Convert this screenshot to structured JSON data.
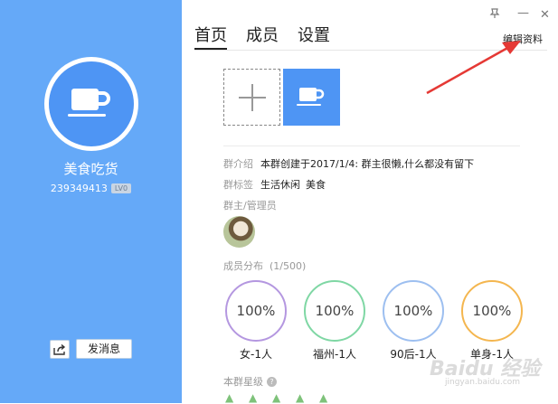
{
  "profile": {
    "name": "美食吃货",
    "group_id": "239349413",
    "level": "LV0",
    "send_message_label": "发消息",
    "share_icon": "share-icon",
    "avatar_icon": "coffee-cup-icon"
  },
  "tabs": [
    {
      "label": "首页",
      "active": true
    },
    {
      "label": "成员",
      "active": false
    },
    {
      "label": "设置",
      "active": false
    }
  ],
  "window": {
    "pin_icon": "pin-icon",
    "minimize_glyph": "—",
    "close_glyph": "✕",
    "edit_profile_label": "编辑资料"
  },
  "intro": {
    "label": "群介绍",
    "text": "本群创建于2017/1/4:  群主很懒,什么都没有留下"
  },
  "tags": {
    "label": "群标签",
    "items": [
      "生活休闲",
      "美食"
    ]
  },
  "admins": {
    "label": "群主/管理员"
  },
  "distribution": {
    "label": "成员分布",
    "total": "(1/500)",
    "stats": [
      {
        "value": "100%",
        "label": "女-1人",
        "color": "#b497e0"
      },
      {
        "value": "100%",
        "label": "福州-1人",
        "color": "#7fd7a4"
      },
      {
        "value": "100%",
        "label": "90后-1人",
        "color": "#9dbff0"
      },
      {
        "value": "100%",
        "label": "单身-1人",
        "color": "#f4b64f"
      }
    ]
  },
  "rating": {
    "label": "本群星级",
    "help_glyph": "?",
    "stars": 5
  },
  "watermark": {
    "brand": "Baidu 经验",
    "url": "jingyan.baidu.com"
  },
  "colors": {
    "sidebar_bg": "#65a9f8",
    "accent": "#4e95f4",
    "annotation_arrow": "#e53935"
  }
}
